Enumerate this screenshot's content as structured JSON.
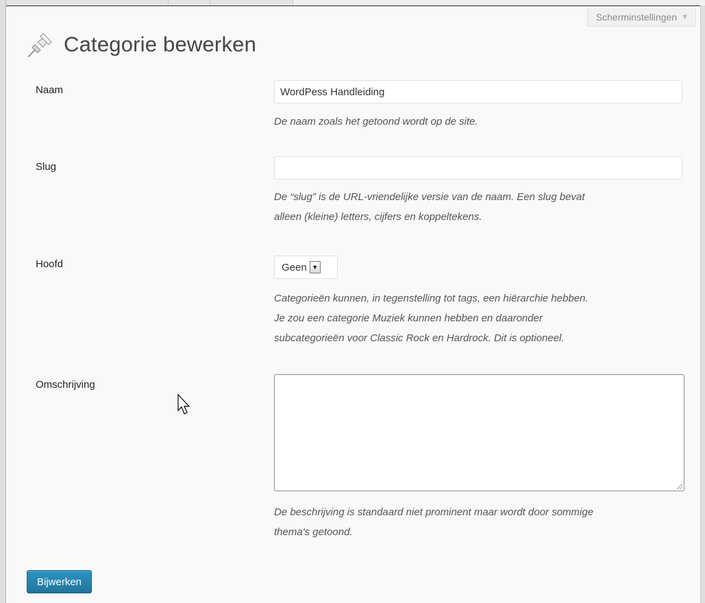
{
  "header": {
    "title": "Categorie bewerken",
    "screen_options_label": "Scherminstellingen",
    "icon": "pushpin-icon"
  },
  "form": {
    "name": {
      "label": "Naam",
      "value": "WordPess Handleiding",
      "description": "De naam zoals het getoond wordt op de site."
    },
    "slug": {
      "label": "Slug",
      "value": "",
      "description_lines": [
        "De “slug” is de URL-vriendelijke versie van de naam. Een slug bevat",
        "alleen (kleine) letters, cijfers en koppeltekens."
      ]
    },
    "parent": {
      "label": "Hoofd",
      "selected": "Geen",
      "description_lines": [
        "Categorieën kunnen, in tegenstelling tot tags, een hiërarchie hebben.",
        "Je zou een categorie Muziek kunnen hebben en daaronder",
        "subcategorieën voor Classic Rock en Hardrock. Dit is optioneel."
      ]
    },
    "description": {
      "label": "Omschrijving",
      "value": "",
      "description_lines": [
        "De beschrijving is standaard niet prominent maar wordt door sommige",
        "thema's getoond."
      ]
    },
    "submit_label": "Bijwerken"
  },
  "colors": {
    "primary_button": "#21759b",
    "background": "#f9f9f9",
    "text": "#222222",
    "description_text": "#555555"
  }
}
